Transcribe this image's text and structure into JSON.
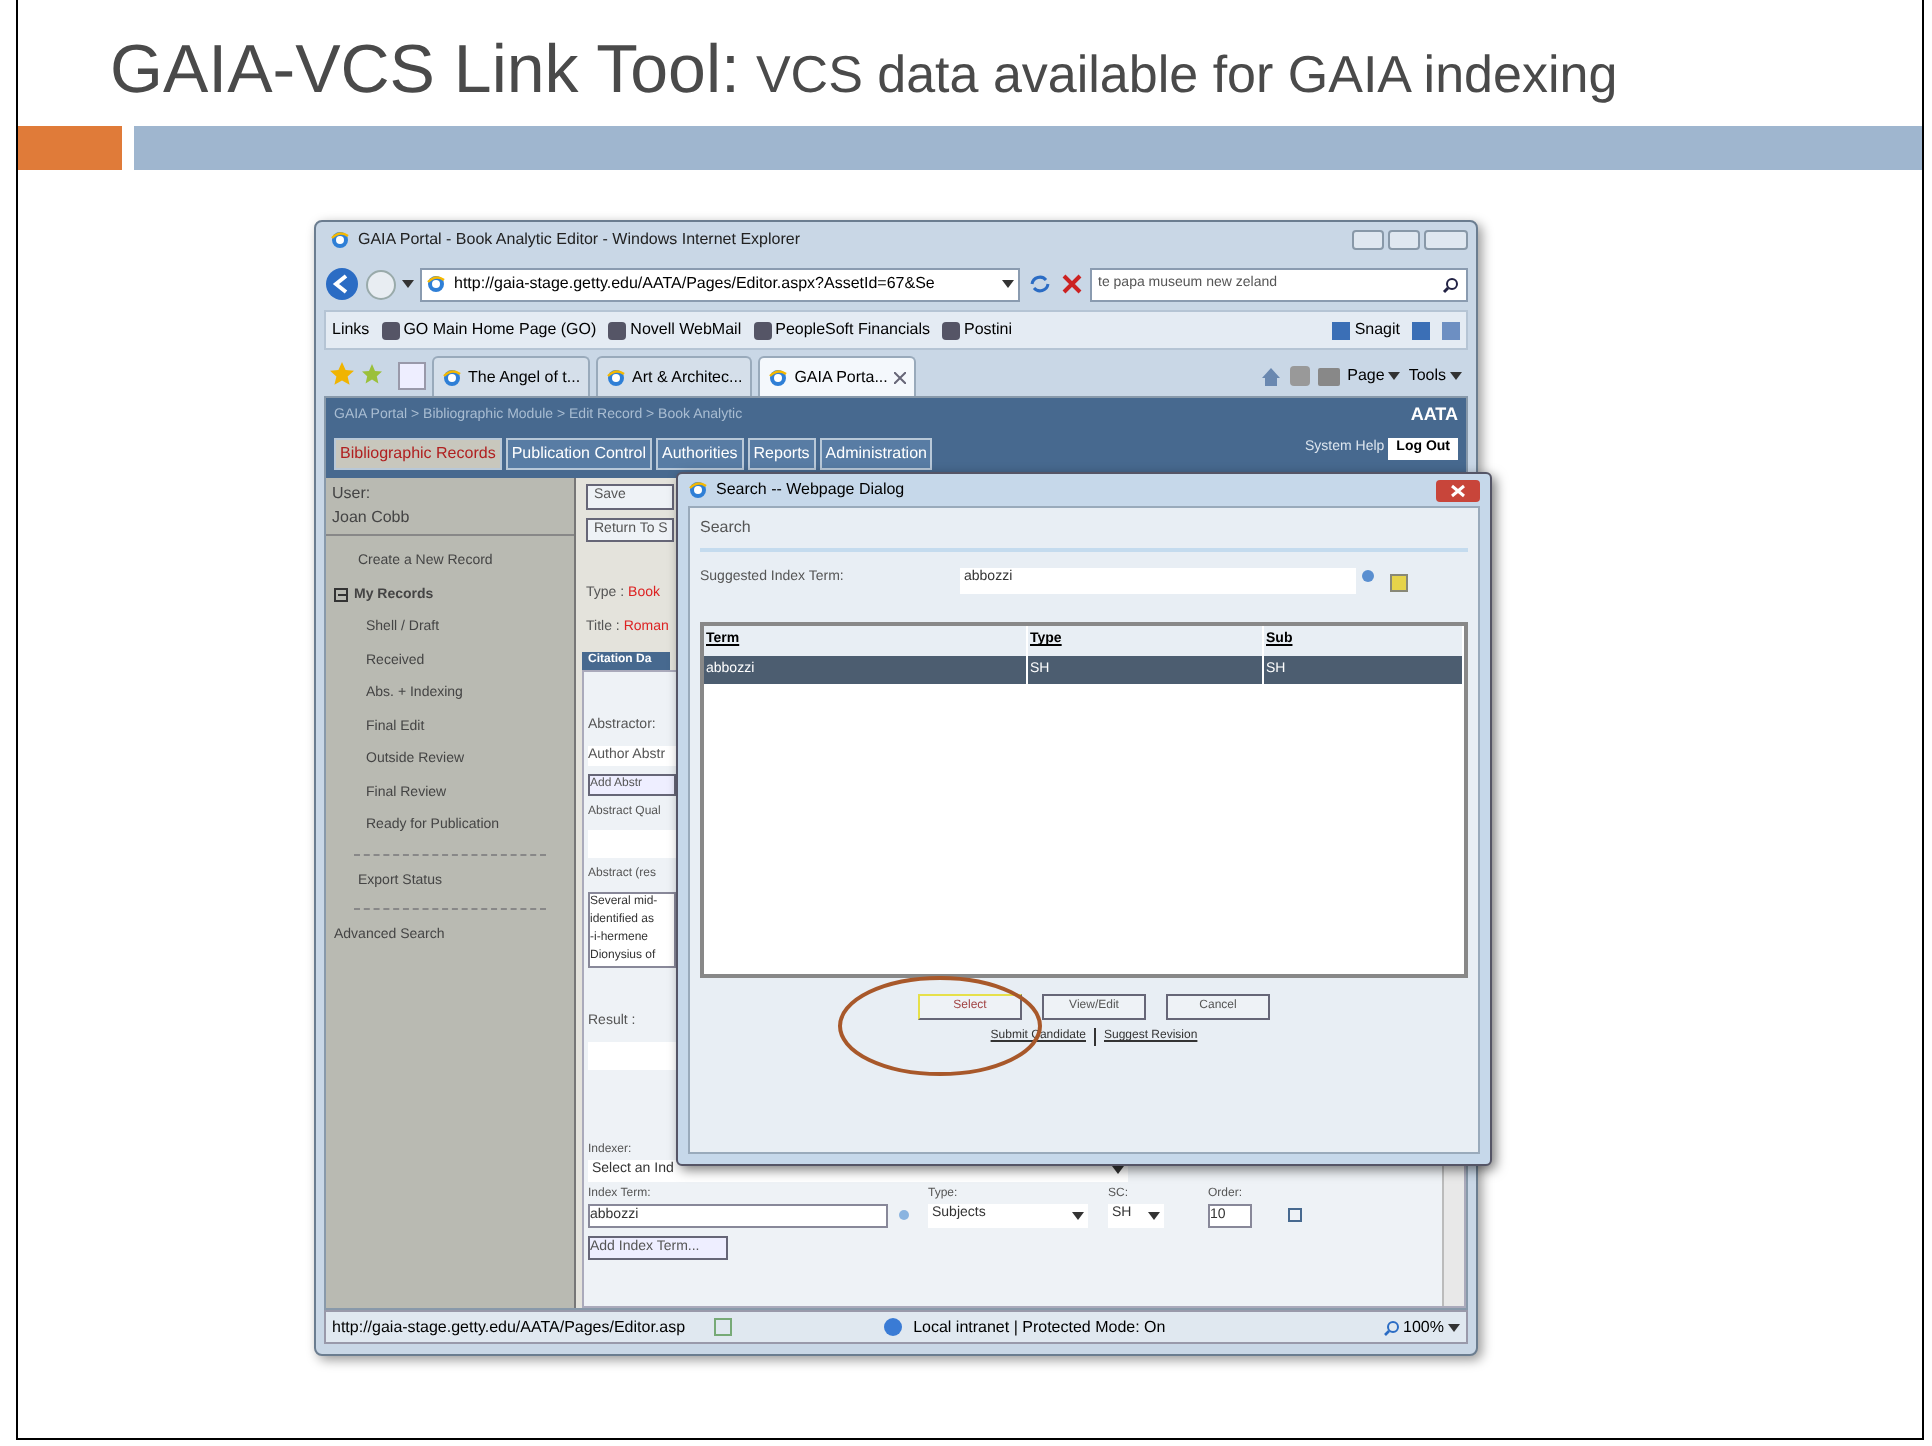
{
  "slide": {
    "title": "GAIA-VCS Link Tool:",
    "subtitle": "VCS data available for GAIA indexing"
  },
  "browser": {
    "title": "GAIA Portal - Book Analytic Editor - Windows Internet Explorer",
    "address": "http://gaia-stage.getty.edu/AATA/Pages/Editor.aspx?AssetId=67&Se",
    "search": "te papa museum new zeland",
    "links_label": "Links",
    "links": [
      "GO Main Home Page (GO)",
      "Novell WebMail",
      "PeopleSoft Financials",
      "Postini"
    ],
    "snagit": "Snagit",
    "tabs": [
      {
        "label": "The Angel of t...",
        "selected": false
      },
      {
        "label": "Art & Architec...",
        "selected": false
      },
      {
        "label": "GAIA Porta...",
        "selected": true
      }
    ],
    "commands": [
      "Page",
      "Tools"
    ],
    "status": {
      "url": "http://gaia-stage.getty.edu/AATA/Pages/Editor.asp",
      "zone": "Local intranet | Protected Mode: On",
      "zoom": "100%"
    }
  },
  "page": {
    "breadcrumb": "GAIA Portal > Bibliographic Module > Edit Record > Book Analytic",
    "logo": "AATA",
    "tabs": [
      {
        "label": "Bibliographic Records",
        "selected": true
      },
      {
        "label": "Publication Control",
        "selected": false
      },
      {
        "label": "Authorities",
        "selected": false
      },
      {
        "label": "Reports",
        "selected": false
      },
      {
        "label": "Administration",
        "selected": false
      }
    ],
    "system_help": "System Help",
    "logout": "Log Out",
    "user_label": "User:",
    "user_name": "Joan Cobb",
    "sidebar": {
      "new_record": "Create a New Record",
      "group": {
        "label": "My Records",
        "expanded": true,
        "children": [
          "Shell / Draft",
          "Received",
          "Abs. + Indexing",
          "Final Edit",
          "Outside Review",
          "Final Review",
          "Ready for Publication"
        ]
      },
      "export": "Export Status",
      "advanced": "Advanced Search"
    },
    "buttons": [
      "Save",
      "Return To S"
    ],
    "type_label": "Type :",
    "type_value": "Book",
    "title_label": "Title :",
    "title_value": "Roman",
    "section_tab": "Citation Da",
    "form": {
      "abstractor_label": "Abstractor:",
      "abstractor_value": "Author Abstr",
      "add_abstract": "Add Abstr",
      "quality_label": "Abstract Qual",
      "abstract_label": "Abstract (res",
      "abstract_lines": [
        "Several mid-",
        "identified as",
        "-i-hermene",
        "Dionysius of"
      ],
      "result_label": "Result :",
      "indexer_label": "Indexer:",
      "indexer_value": "Select an Ind",
      "index_term_label": "Index Term:",
      "index_term_value": "abbozzi",
      "type_label": "Type:",
      "type_value": "Subjects",
      "sc_label": "SC:",
      "sc_value": "SH",
      "order_label": "Order:",
      "order_value": "10",
      "add_index_term": "Add Index Term..."
    }
  },
  "dialog": {
    "title": "Search -- Webpage Dialog",
    "heading": "Search",
    "field_label": "Suggested Index Term:",
    "field_value": "abbozzi",
    "columns": [
      "Term",
      "Type",
      "Sub"
    ],
    "rows": [
      {
        "cells": [
          "abbozzi",
          "SH",
          "SH"
        ],
        "selected": true
      }
    ],
    "buttons": [
      "Select",
      "View/Edit",
      "Cancel"
    ],
    "links": [
      "Submit Candidate",
      "Suggest Revision"
    ]
  }
}
